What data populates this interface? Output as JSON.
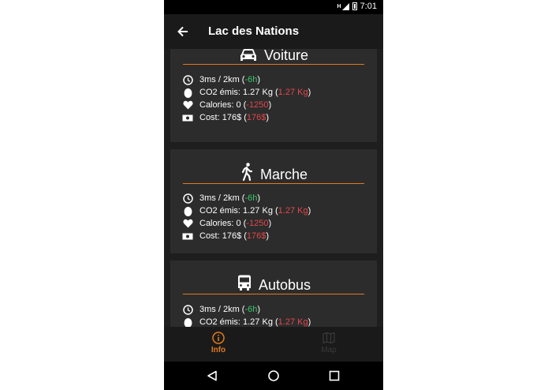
{
  "status_bar": {
    "time": "7:01"
  },
  "app_bar": {
    "title": "Lac des Nations",
    "back_icon": "arrow-left-icon"
  },
  "cards": [
    {
      "mode": "Voiture",
      "icon": "car-icon",
      "time_value": "3ms / 2km (",
      "time_delta": "-6h",
      "co2_value": "CO2 émis: 1.27 Kg (",
      "co2_delta": "1.27 Kg",
      "calories_value": "Calories: 0 (",
      "calories_delta": "-1250",
      "cost_value": "Cost: 176$ (",
      "cost_delta": "176$",
      "close": ")"
    },
    {
      "mode": "Marche",
      "icon": "walking-person-icon",
      "time_value": "3ms / 2km (",
      "time_delta": "-6h",
      "co2_value": "CO2 émis: 1.27 Kg (",
      "co2_delta": "1.27 Kg",
      "calories_value": "Calories: 0 (",
      "calories_delta": "-1250",
      "cost_value": "Cost: 176$ (",
      "cost_delta": "176$",
      "close": ")"
    },
    {
      "mode": "Autobus",
      "icon": "bus-icon",
      "time_value": "3ms / 2km (",
      "time_delta": "-6h",
      "co2_value": "CO2 émis: 1.27 Kg (",
      "co2_delta": "1.27 Kg",
      "close": ")"
    }
  ],
  "bottom_nav": {
    "items": [
      {
        "label": "Info",
        "icon": "info-icon",
        "active": true
      },
      {
        "label": "Map",
        "icon": "map-icon",
        "active": false
      }
    ]
  },
  "colors": {
    "accent": "#e07a20",
    "positive": "#3ec46d",
    "negative": "#e2474b",
    "card_bg": "#2c2c2c",
    "screen_bg": "#1e1e1e"
  }
}
